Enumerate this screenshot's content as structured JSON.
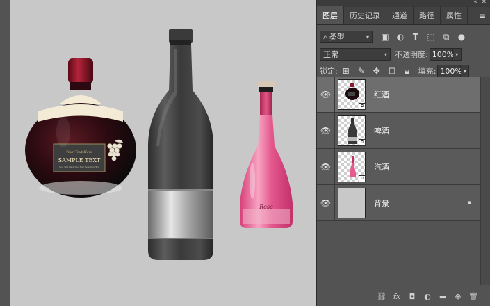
{
  "panel": {
    "tabs": [
      {
        "label": "图层",
        "active": true
      },
      {
        "label": "历史记录"
      },
      {
        "label": "通道"
      },
      {
        "label": "路径"
      },
      {
        "label": "属性"
      }
    ],
    "filter": {
      "kind_label": "类型"
    },
    "blend": {
      "mode": "正常",
      "opacity_label": "不透明度:",
      "opacity_value": "100%"
    },
    "lock": {
      "label": "锁定:",
      "fill_label": "填充:",
      "fill_value": "100%"
    },
    "layers": [
      {
        "name": "红酒",
        "visible": true,
        "thumb": "red-wine-thumbnail"
      },
      {
        "name": "啤酒",
        "visible": true,
        "thumb": "beer-bottle-thumbnail"
      },
      {
        "name": "汽酒",
        "visible": true,
        "thumb": "sparkling-wine-thumbnail"
      },
      {
        "name": "背景",
        "visible": true,
        "locked": true,
        "thumb": "background-thumbnail"
      }
    ]
  },
  "canvas": {
    "background_color": "#c8c8c8",
    "guide_color": "#e04a4a",
    "label": {
      "script_line": "Your Text Here",
      "title": "SAMPLE TEXT",
      "small_line": "Your Text Here Your Text Here Your Text",
      "rose_label": "Rosé"
    }
  },
  "colors": {
    "panel_bg": "#535353",
    "selected_layer": "#6e6e6e",
    "wine_red": "#8b1a2b",
    "rose_pink": "#e85a8e"
  }
}
